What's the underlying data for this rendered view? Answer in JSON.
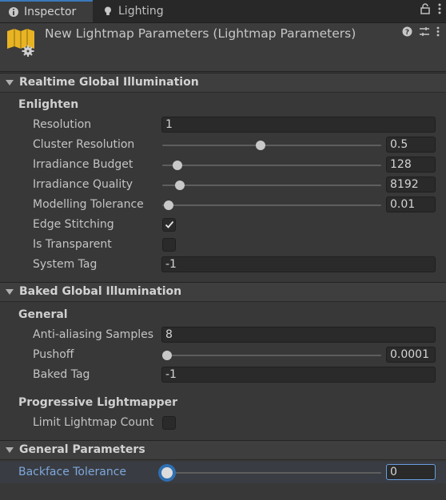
{
  "tabs": [
    {
      "label": "Inspector",
      "icon": "info-icon",
      "active": true
    },
    {
      "label": "Lighting",
      "icon": "lightbulb-icon",
      "active": false
    }
  ],
  "header": {
    "title": "New Lightmap Parameters (Lightmap Parameters)",
    "icons": [
      "help-icon",
      "presets-icon",
      "more-icon"
    ]
  },
  "sections": {
    "realtime": {
      "title": "Realtime Global Illumination",
      "subheading": "Enlighten",
      "resolution": {
        "label": "Resolution",
        "value": "1"
      },
      "cluster_resolution": {
        "label": "Cluster Resolution",
        "value": "0.5",
        "slider": 0.45
      },
      "irradiance_budget": {
        "label": "Irradiance Budget",
        "value": "128",
        "slider": 0.07
      },
      "irradiance_quality": {
        "label": "Irradiance Quality",
        "value": "8192",
        "slider": 0.08
      },
      "modelling_tolerance": {
        "label": "Modelling Tolerance",
        "value": "0.01",
        "slider": 0.03
      },
      "edge_stitching": {
        "label": "Edge Stitching",
        "checked": true
      },
      "is_transparent": {
        "label": "Is Transparent",
        "checked": false
      },
      "system_tag": {
        "label": "System Tag",
        "value": "-1"
      }
    },
    "baked": {
      "title": "Baked Global Illumination",
      "subheading": "General",
      "anti_aliasing": {
        "label": "Anti-aliasing Samples",
        "value": "8"
      },
      "pushoff": {
        "label": "Pushoff",
        "value": "0.0001",
        "slider": 0.0
      },
      "baked_tag": {
        "label": "Baked Tag",
        "value": "-1"
      },
      "progressive_heading": "Progressive Lightmapper",
      "limit_count": {
        "label": "Limit Lightmap Count",
        "checked": false
      }
    },
    "general": {
      "title": "General Parameters",
      "backface": {
        "label": "Backface Tolerance",
        "value": "0",
        "slider": 0.0
      }
    }
  },
  "colors": {
    "accent": "#3a79bb",
    "highlight_label": "#7ea8dc"
  }
}
